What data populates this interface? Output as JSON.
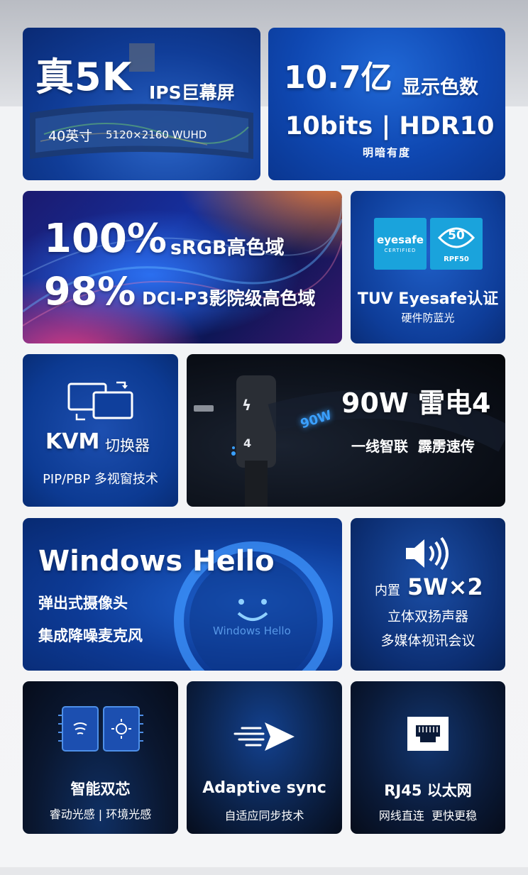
{
  "colors": {
    "primary_blue": "#0f48b2",
    "dark_bg": "#0a0e16",
    "accent_cyan": "#3aa0ff"
  },
  "cards": {
    "c1": {
      "headline_big": "真5K",
      "headline_small": "IPS巨幕屏",
      "size": "40英寸",
      "resolution": "5120×2160 WUHD"
    },
    "c2": {
      "line1_big": "10.7亿",
      "line1_small": "显示色数",
      "line2": "10bits | HDR10",
      "line3": "明暗有度"
    },
    "c3": {
      "line1_big": "100%",
      "line1_small": "sRGB高色域",
      "line2_big": "98%",
      "line2_small": "DCI-P3影院级高色域"
    },
    "c4": {
      "badge_eyesafe_title": "eyesafe",
      "badge_eyesafe_sub": "CERTIFIED",
      "badge_rpf_value": "50",
      "badge_rpf_label": "RPF50",
      "title": "TUV Eyesafe认证",
      "subtitle": "硬件防蓝光"
    },
    "c5": {
      "title_big": "KVM",
      "title_small": "切换器",
      "subtitle": "PIP/PBP 多视窗技术"
    },
    "c6": {
      "title": "90W 雷电4",
      "subtitle": "一线智联  霹雳速传",
      "port_glyph": "ϟ",
      "port_num": "4",
      "neon_text": "90W"
    },
    "c7": {
      "title": "Windows Hello",
      "line1": "弹出式摄像头",
      "line2": "集成降噪麦克风",
      "watermark": "Windows Hello"
    },
    "c8": {
      "prefix": "内置",
      "value": "5W×2",
      "line1": "立体双扬声器",
      "line2": "多媒体视讯会议"
    },
    "c9": {
      "title": "智能双芯",
      "subtitle": "睿动光感 | 环境光感"
    },
    "c10": {
      "title": "Adaptive sync",
      "subtitle": "自适应同步技术"
    },
    "c11": {
      "title": "RJ45 以太网",
      "subtitle": "网线直连  更快更稳"
    }
  }
}
